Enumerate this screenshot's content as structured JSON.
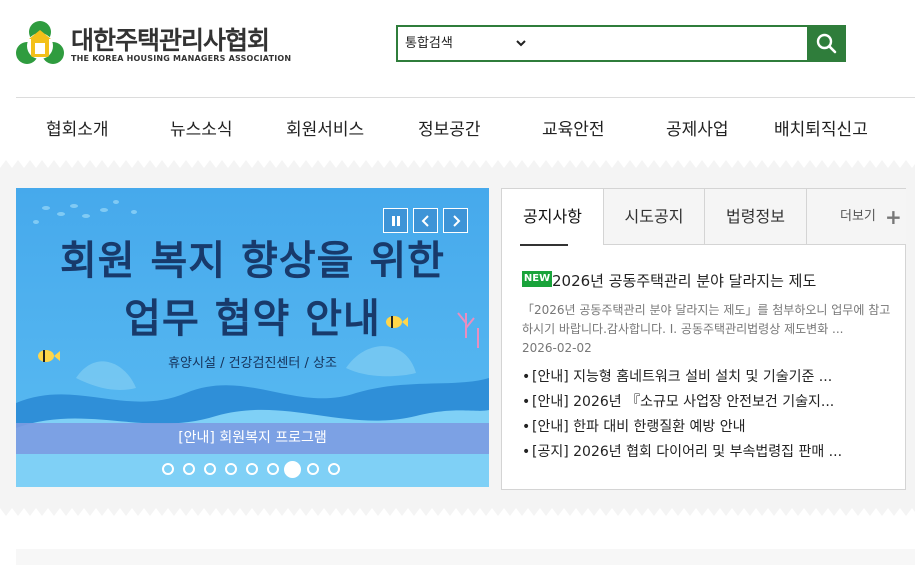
{
  "header": {
    "org_name": "대한주택관리사협회",
    "org_name_en": "THE KOREA HOUSING MANAGERS ASSOCIATION",
    "brand_color": "#2f7d3b",
    "search": {
      "scope_selected": "통합검색",
      "placeholder": "",
      "button_icon": "search-icon"
    }
  },
  "nav": {
    "items": [
      {
        "label": "협회소개"
      },
      {
        "label": "뉴스소식"
      },
      {
        "label": "회원서비스"
      },
      {
        "label": "정보공간"
      },
      {
        "label": "교육안전"
      },
      {
        "label": "공제사업"
      },
      {
        "label": "배치퇴직신고"
      }
    ]
  },
  "banner": {
    "title_line1": "회원 복지 향상을 위한",
    "title_line2": "업무 협약 안내",
    "subtitle": "휴양시설 / 건강검진센터 / 상조",
    "caption": "[안내] 회원복지 프로그램",
    "controls": {
      "pause_icon": "pause-icon",
      "prev_icon": "chevron-left-icon",
      "next_icon": "chevron-right-icon"
    },
    "slide_count": 9,
    "active_slide": 7
  },
  "notice": {
    "tabs": [
      {
        "label": "공지사항",
        "active": true
      },
      {
        "label": "시도공지",
        "active": false
      },
      {
        "label": "법령정보",
        "active": false
      }
    ],
    "more_label": "더보기",
    "featured": {
      "badge": "NEW",
      "title": "2026년 공동주택관리 분야 달라지는 제도",
      "desc": "「2026년 공동주택관리 분야 달라지는 제도」를 첨부하오니 업무에 참고하시기 바랍니다.감사합니다. Ⅰ. 공동주택관리법령상 제도변화 ...",
      "date": "2026-02-02"
    },
    "items": [
      {
        "text": "[안내] 지능형 홈네트워크 설비 설치 및 기술기준 ..."
      },
      {
        "text": "[안내] 2026년 『소규모 사업장 안전보건 기술지..."
      },
      {
        "text": "[안내] 한파 대비 한랭질환 예방 안내"
      },
      {
        "text": "[공지] 2026년 협회 다이어리 및 부속법령집 판매 ..."
      }
    ]
  }
}
